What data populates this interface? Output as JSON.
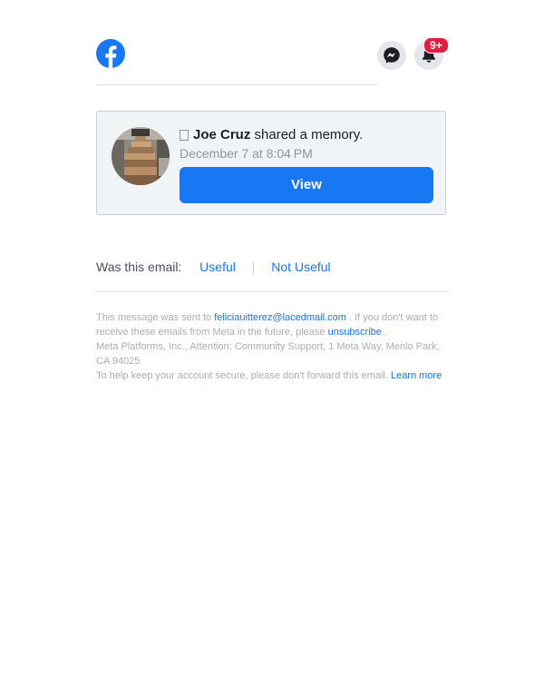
{
  "notifications": {
    "badge": "9+"
  },
  "card": {
    "actor_name": "Joe Cruz",
    "action_text": "shared a memory.",
    "date": "December 7 at 8:04 PM",
    "button_label": "View"
  },
  "feedback": {
    "question": "Was this email:",
    "useful": "Useful",
    "separator": "|",
    "not_useful": "Not Useful"
  },
  "footer": {
    "sent_prefix": "This message was sent to",
    "email": "feliciauitterez@lacedmail.com",
    "unsub_text": ". If you don't want to receive these emails from Meta in the future, please",
    "unsubscribe": "unsubscribe",
    "unsub_end": ".",
    "address": "Meta Platforms, Inc., Attention: Community Support, 1 Meta Way, Menlo Park, CA 94025",
    "secure_text": "To help keep your account secure, please don't forward this email.",
    "learn_more": "Learn more"
  },
  "colors": {
    "brand": "#1877F2",
    "badge": "#E41E3F",
    "card_bg": "#F0F4F7"
  }
}
